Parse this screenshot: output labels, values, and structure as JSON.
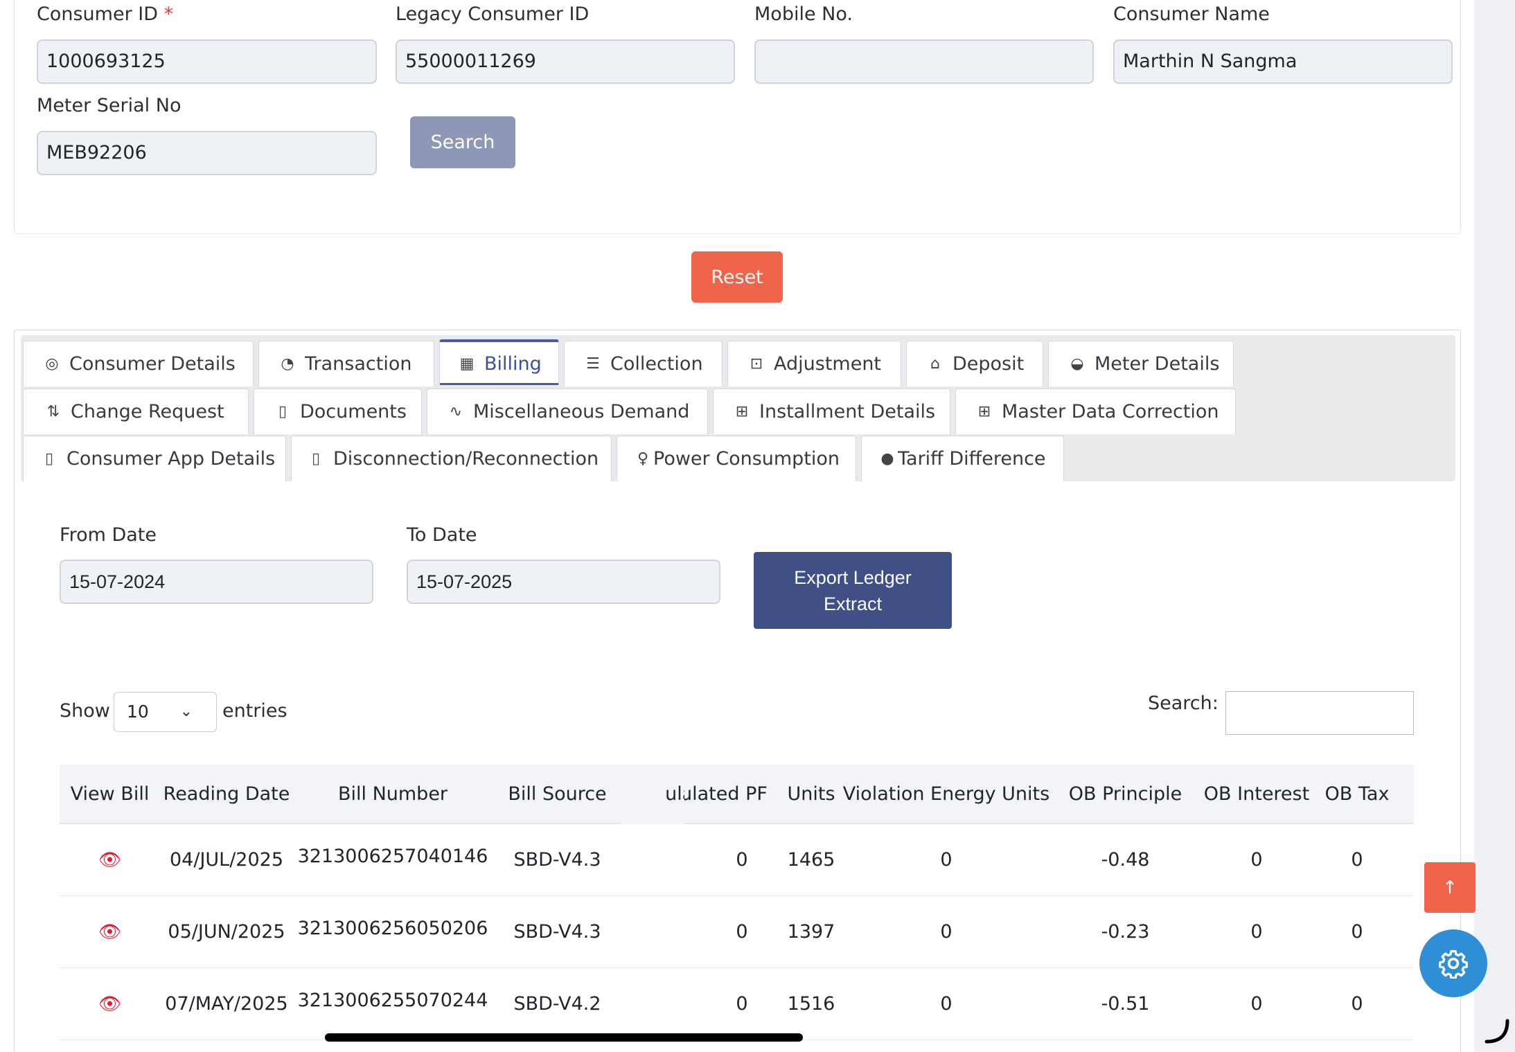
{
  "form": {
    "consumer_id": {
      "label": "Consumer ID",
      "required_mark": "*",
      "value": "1000693125"
    },
    "legacy_consumer_id": {
      "label": "Legacy Consumer ID",
      "value": "55000011269"
    },
    "mobile_no": {
      "label": "Mobile No.",
      "value": ""
    },
    "consumer_name": {
      "label": "Consumer Name",
      "value": "Marthin N Sangma"
    },
    "meter_serial_no": {
      "label": "Meter Serial No",
      "value": "MEB92206"
    },
    "search_label": "Search",
    "reset_label": "Reset"
  },
  "tabs": [
    {
      "label": "Consumer Details",
      "icon": "target-icon",
      "glyph": "◎"
    },
    {
      "label": "Transaction",
      "icon": "pie-chart-icon",
      "glyph": "◔"
    },
    {
      "label": "Billing",
      "icon": "bar-chart-icon",
      "glyph": "▦",
      "active": true
    },
    {
      "label": "Collection",
      "icon": "list-icon",
      "glyph": "☰"
    },
    {
      "label": "Adjustment",
      "icon": "terminal-icon",
      "glyph": "⊡"
    },
    {
      "label": "Deposit",
      "icon": "bank-icon",
      "glyph": "⌂"
    },
    {
      "label": "Meter Details",
      "icon": "speedometer-icon",
      "glyph": "◒"
    },
    {
      "label": "Change Request",
      "icon": "git-compare-icon",
      "glyph": "⇅"
    },
    {
      "label": "Documents",
      "icon": "document-icon",
      "glyph": "▯"
    },
    {
      "label": "Miscellaneous Demand",
      "icon": "activity-icon",
      "glyph": "∿"
    },
    {
      "label": "Installment Details",
      "icon": "plus-square-icon",
      "glyph": "⊞"
    },
    {
      "label": "Master Data Correction",
      "icon": "plus-square-icon",
      "glyph": "⊞"
    },
    {
      "label": "Consumer App Details",
      "icon": "phone-icon",
      "glyph": "▯"
    },
    {
      "label": "Disconnection/Reconnection",
      "icon": "phone-icon",
      "glyph": "▯"
    },
    {
      "label": "Power Consumption",
      "icon": "lightbulb-icon",
      "glyph": "♀"
    },
    {
      "label": "Tariff Difference",
      "icon": "circle-icon",
      "glyph": "●"
    }
  ],
  "billing": {
    "from_date": {
      "label": "From Date",
      "value": "15-07-2024"
    },
    "to_date": {
      "label": "To Date",
      "value": "15-07-2025"
    },
    "export_label": "Export Ledger Extract",
    "show_label": "Show",
    "page_size": "10",
    "entries_label": "entries",
    "search_label": "Search:",
    "search_value": ""
  },
  "table": {
    "columns": [
      "View Bill",
      "Reading Date",
      "Bill Number",
      "Bill Source",
      "ulated PF",
      "Units",
      "Violation Energy Units",
      "OB Principle",
      "OB Interest",
      "OB Tax"
    ],
    "rows": [
      {
        "reading_date": "04/JUL/2025",
        "bill_number": "3213006257040146",
        "bill_source": "SBD-V4.3",
        "pf": "0",
        "units": "1465",
        "violation_units": "0",
        "ob_principle": "-0.48",
        "ob_interest": "0",
        "ob_tax": "0"
      },
      {
        "reading_date": "05/JUN/2025",
        "bill_number": "3213006256050206",
        "bill_source": "SBD-V4.3",
        "pf": "0",
        "units": "1397",
        "violation_units": "0",
        "ob_principle": "-0.23",
        "ob_interest": "0",
        "ob_tax": "0"
      },
      {
        "reading_date": "07/MAY/2025",
        "bill_number": "3213006255070244",
        "bill_source": "SBD-V4.2",
        "pf": "0",
        "units": "1516",
        "violation_units": "0",
        "ob_principle": "-0.51",
        "ob_interest": "0",
        "ob_tax": "0"
      }
    ]
  },
  "floating": {
    "scroll_top_icon": "arrow-up-icon",
    "settings_icon": "gear-icon"
  },
  "colors": {
    "reset": "#f0654a",
    "export": "#414f87",
    "search_button": "#8e98b6",
    "active_tab": "#3d4f9a",
    "view_icon": "#e8182e",
    "settings": "#2f8fd6"
  }
}
